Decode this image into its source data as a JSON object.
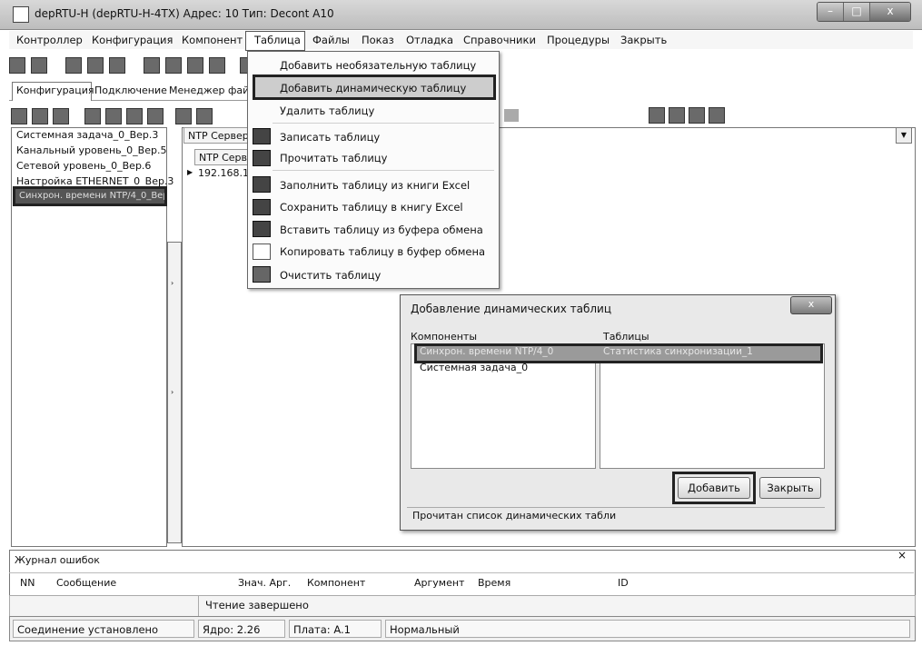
{
  "window": {
    "title": "depRTU-H (depRTU-H-4TX)   Адрес: 10   Тип: Decont A10",
    "controls": [
      "–",
      "□",
      "x"
    ]
  },
  "menubar": {
    "items": [
      "Контроллер",
      "Конфигурация",
      "Компонент",
      "Таблица",
      "Файлы",
      "Показ",
      "Отладка",
      "Справочники",
      "Процедуры",
      "Закрыть"
    ],
    "active": "Таблица"
  },
  "tabs": {
    "items": [
      "Конфигурация",
      "Подключение",
      "Менеджер файлов"
    ],
    "active": "Конфигурация"
  },
  "tree": {
    "items": [
      "Системная задача_0_Вер.3",
      "Канальный уровень_0_Вер.5",
      "Сетевой уровень_0_Вер.6",
      "Настройка ETHERNET_0_Вер.3",
      "Синхрон. времени NTP/4_0_Вер"
    ],
    "selected_index": 4
  },
  "right_panel": {
    "tab_label": "NTP Серверы",
    "grid_header": "NTP Сервер",
    "grid_row_value": "192.168.1."
  },
  "dropdown": {
    "items": [
      {
        "label": "Добавить необязательную таблицу",
        "icon": "none"
      },
      {
        "label": "Добавить динамическую таблицу",
        "icon": "none",
        "highlighted": true
      },
      {
        "label": "Удалить таблицу",
        "icon": "none"
      },
      {
        "label": "Записать таблицу",
        "icon": "table-write-icon"
      },
      {
        "label": "Прочитать таблицу",
        "icon": "table-read-icon"
      },
      {
        "label": "Заполнить таблицу из книги Excel",
        "icon": "excel-import-icon"
      },
      {
        "label": "Сохранить таблицу в книгу Excel",
        "icon": "excel-export-icon"
      },
      {
        "label": "Вставить таблицу из буфера обмена",
        "icon": "paste-icon"
      },
      {
        "label": "Копировать таблицу в буфер обмена",
        "icon": "copy-icon"
      },
      {
        "label": "Очистить таблицу",
        "icon": "clear-icon"
      }
    ]
  },
  "dialog": {
    "title": "Добавление динамических таблиц",
    "close_label": "x",
    "components_label": "Компоненты",
    "tables_label": "Таблицы",
    "components": [
      "Синхрон. времени NTP/4_0",
      "Системная задача_0"
    ],
    "tables": [
      "Статистика синхронизации_1"
    ],
    "add_button": "Добавить",
    "close_button": "Закрыть",
    "status": "Прочитан список динамических табли"
  },
  "error_log": {
    "title": "Журнал ошибок",
    "close_label": "×",
    "columns": [
      "NN",
      "Сообщение",
      "Знач. Арг.",
      "Компонент",
      "Аргумент",
      "Время",
      "ID"
    ]
  },
  "status": {
    "message": "Чтение завершено",
    "connection": "Соединение установлено",
    "core": "Ядро: 2.26",
    "board": "Плата: A.1",
    "mode": "Нормальный"
  }
}
